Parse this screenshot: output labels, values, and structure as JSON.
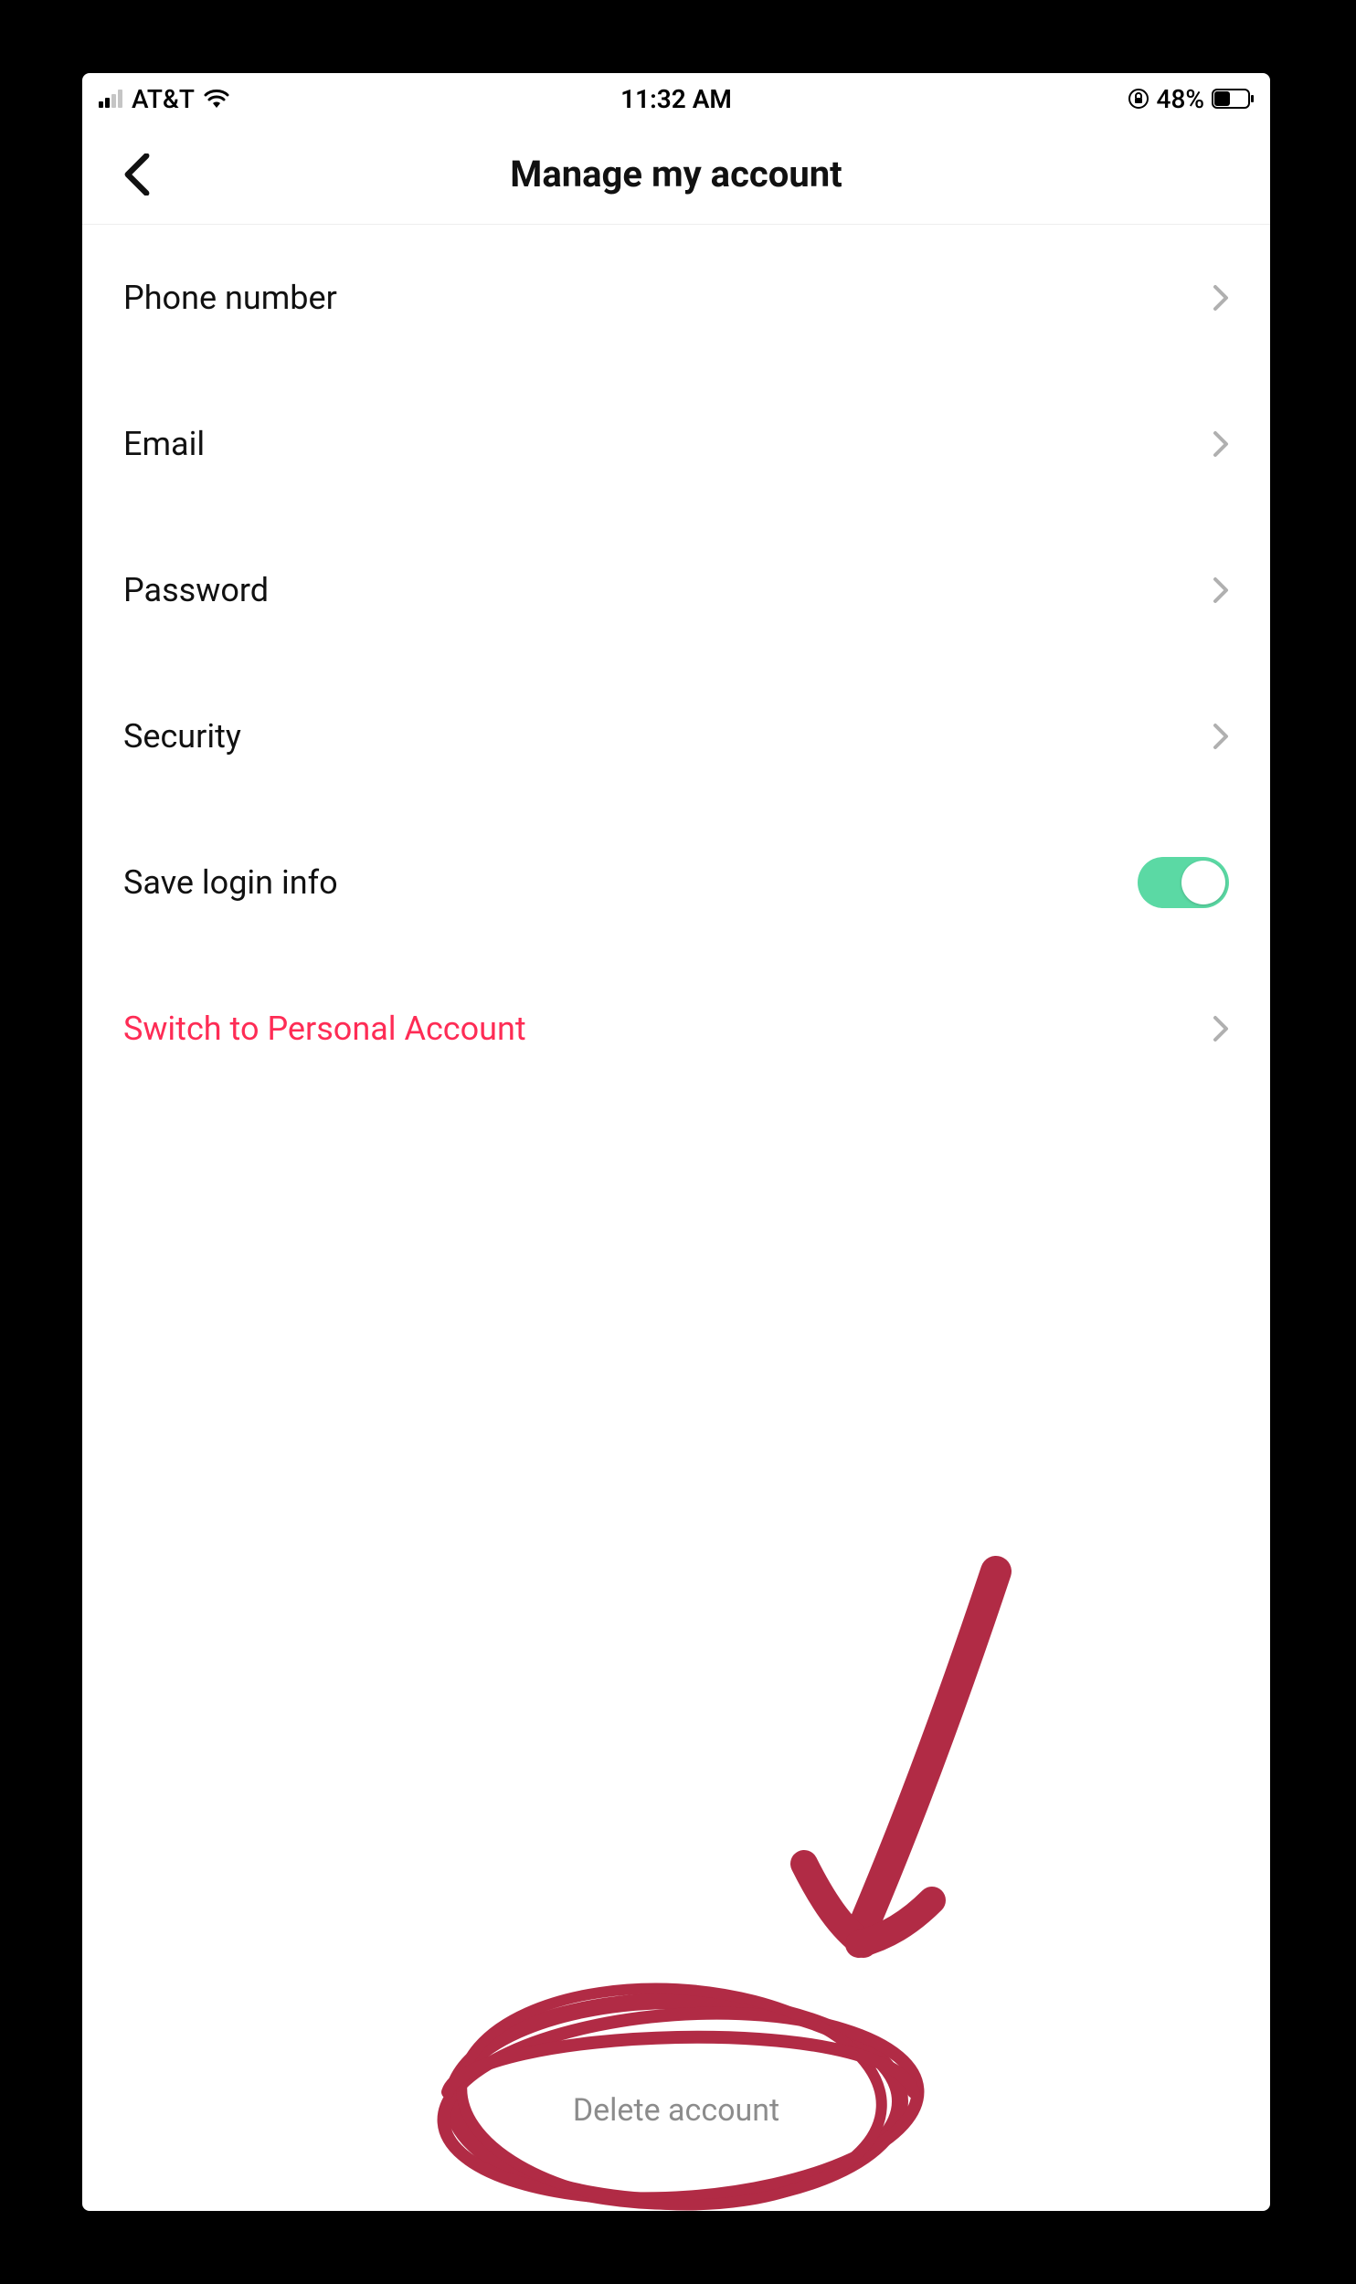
{
  "status": {
    "carrier": "AT&T",
    "time": "11:32 AM",
    "battery_pct": "48%"
  },
  "header": {
    "title": "Manage my account"
  },
  "rows": {
    "phone": {
      "label": "Phone number"
    },
    "email": {
      "label": "Email"
    },
    "password": {
      "label": "Password"
    },
    "security": {
      "label": "Security"
    },
    "save_login": {
      "label": "Save login info"
    },
    "switch": {
      "label": "Switch to Personal Account"
    }
  },
  "footer": {
    "delete": "Delete account"
  }
}
